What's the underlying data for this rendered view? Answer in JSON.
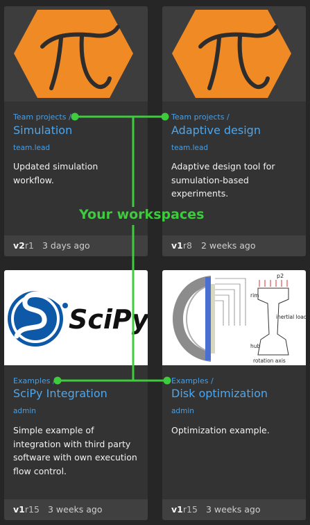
{
  "cards": [
    {
      "breadcrumb": "Team projects /",
      "title": "Simulation",
      "author": "team.lead",
      "description": "Updated simulation workflow.",
      "version_major": "v2",
      "version_rev": "r1",
      "time": "3 days ago",
      "thumbnail": "pi-hexagon-logo"
    },
    {
      "breadcrumb": "Team projects /",
      "title": "Adaptive design",
      "author": "team.lead",
      "description": "Adaptive design tool for sumulation-based experiments.",
      "version_major": "v1",
      "version_rev": "r8",
      "time": "2 weeks ago",
      "thumbnail": "pi-hexagon-logo"
    },
    {
      "breadcrumb": "Examples /",
      "title": "SciPy Integration",
      "author": "admin",
      "description": "Simple example of integration with third party software with own execution flow control.",
      "version_major": "v1",
      "version_rev": "r15",
      "time": "3 weeks ago",
      "thumbnail": "scipy-logo",
      "logo_text": "SciPy"
    },
    {
      "breadcrumb": "Examples /",
      "title": "Disk optimization",
      "author": "admin",
      "description": "Optimization example.",
      "version_major": "v1",
      "version_rev": "r15",
      "time": "3 weeks ago",
      "thumbnail": "disk-diagram",
      "diagram_labels": {
        "p2": "p2",
        "rim": "rim",
        "load": "inertial load",
        "hub": "hub",
        "axis": "rotation axis"
      }
    }
  ],
  "annotation": {
    "label": "Your workspaces",
    "color": "#3ecb3e"
  },
  "colors": {
    "background": "#262626",
    "card": "#333333",
    "footer": "#404040",
    "link": "#4ea6ec",
    "logo_orange": "#f08a24"
  }
}
